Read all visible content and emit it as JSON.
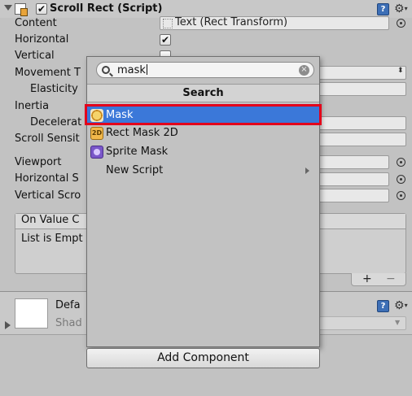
{
  "component": {
    "title": "Scroll Rect (Script)",
    "enabled_mark": "✔"
  },
  "properties": {
    "content": "Content",
    "content_value": "Text (Rect Transform)",
    "horizontal": "Horizontal",
    "horizontal_mark": "✔",
    "vertical": "Vertical",
    "movement_type": "Movement T",
    "elasticity": "Elasticity",
    "inertia": "Inertia",
    "deceleration": "Decelerat",
    "scroll_sensitivity": "Scroll Sensit",
    "viewport": "Viewport",
    "horizontal_scrollbar": "Horizontal S",
    "vertical_scrollbar": "Vertical Scro"
  },
  "event": {
    "header": "On Value C",
    "empty": "List is Empt",
    "plus": "+",
    "minus": "−"
  },
  "material": {
    "name": "Defa",
    "shader": "Shad"
  },
  "popup": {
    "search_value": "mask",
    "search_header": "Search",
    "items": [
      {
        "label": "Mask",
        "icon": "mask-icon",
        "selected": true
      },
      {
        "label": "Rect Mask 2D",
        "icon": "rect-mask-2d-icon",
        "badge": "2D"
      },
      {
        "label": "Sprite Mask",
        "icon": "sprite-mask-icon"
      },
      {
        "label": "New Script",
        "icon": "none",
        "has_submenu": true
      }
    ]
  },
  "add_component_label": "Add Component",
  "colors": {
    "selection": "#3b78d9",
    "highlight_outline": "#e3001b",
    "help_icon": "#3d6fb6"
  }
}
